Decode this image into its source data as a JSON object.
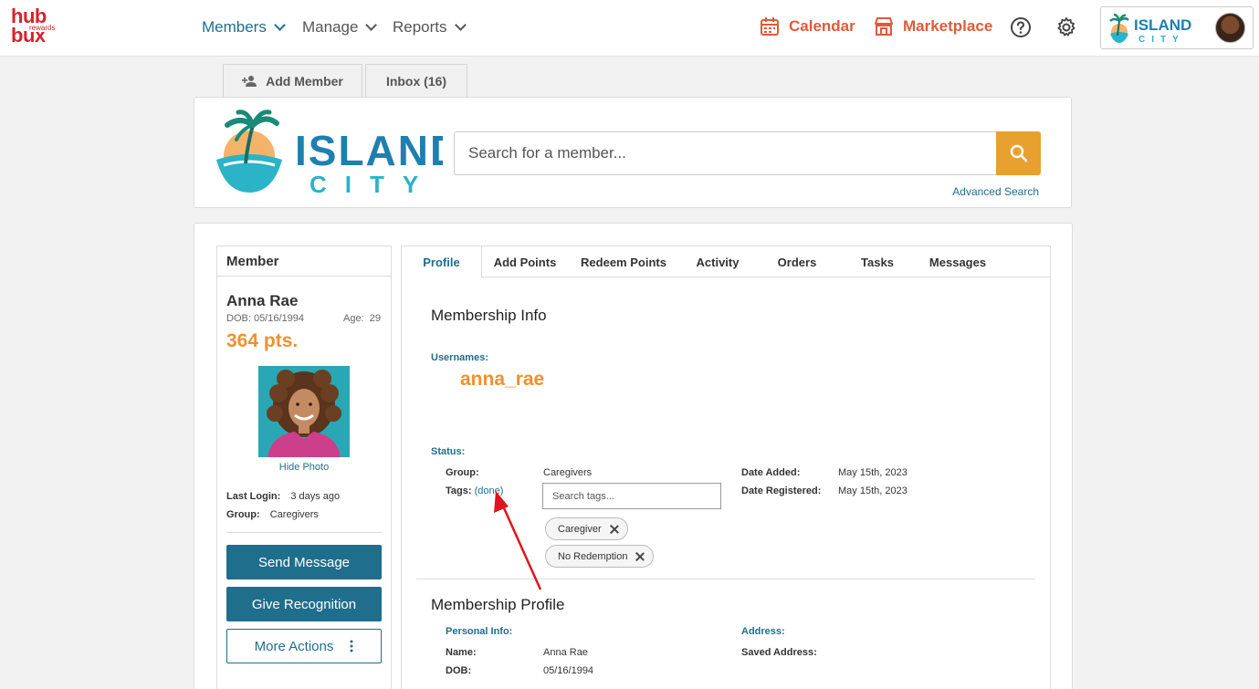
{
  "brand": {
    "line1": "hub",
    "line2": "bux",
    "tagline": "rewards"
  },
  "nav": {
    "members": "Members",
    "manage": "Manage",
    "reports": "Reports",
    "calendar": "Calendar",
    "marketplace": "Marketplace"
  },
  "org": {
    "line1": "ISLAND",
    "line2": "CITY"
  },
  "top_tabs": {
    "add_member": "Add Member",
    "inbox": "Inbox (16)"
  },
  "search": {
    "placeholder": "Search for a member...",
    "advanced": "Advanced Search"
  },
  "member": {
    "panel_title": "Member",
    "name": "Anna Rae",
    "dob": "DOB: 05/16/1994",
    "age_label": "Age:",
    "age": "29",
    "points": "364 pts.",
    "hide_photo": "Hide Photo",
    "last_login_label": "Last Login:",
    "last_login": "3 days ago",
    "group_label": "Group:",
    "group": "Caregivers",
    "send_message": "Send Message",
    "give_recognition": "Give Recognition",
    "more_actions": "More Actions"
  },
  "profile_tabs": [
    "Profile",
    "Add Points",
    "Redeem Points",
    "Activity",
    "Orders",
    "Tasks",
    "Messages"
  ],
  "membership_info": {
    "title": "Membership Info",
    "usernames_label": "Usernames:",
    "username": "anna_rae",
    "status_label": "Status:",
    "group_label": "Group:",
    "group": "Caregivers",
    "tags_label": "Tags:",
    "done_link": "(done)",
    "tags_placeholder": "Search tags...",
    "tags": [
      "Caregiver",
      "No Redemption"
    ],
    "date_added_label": "Date Added:",
    "date_added": "May 15th, 2023",
    "date_registered_label": "Date Registered:",
    "date_registered": "May 15th, 2023"
  },
  "membership_profile": {
    "title": "Membership Profile",
    "personal_info_label": "Personal Info:",
    "name_label": "Name:",
    "name": "Anna Rae",
    "dob_label": "DOB:",
    "dob": "05/16/1994",
    "address_label": "Address:",
    "saved_address_label": "Saved Address:"
  },
  "colors": {
    "accent": "#1f6e8c",
    "orange": "#f0912f",
    "search_button": "#e8a12e",
    "brand_red": "#d6232c",
    "annotation": "#e0141c"
  }
}
